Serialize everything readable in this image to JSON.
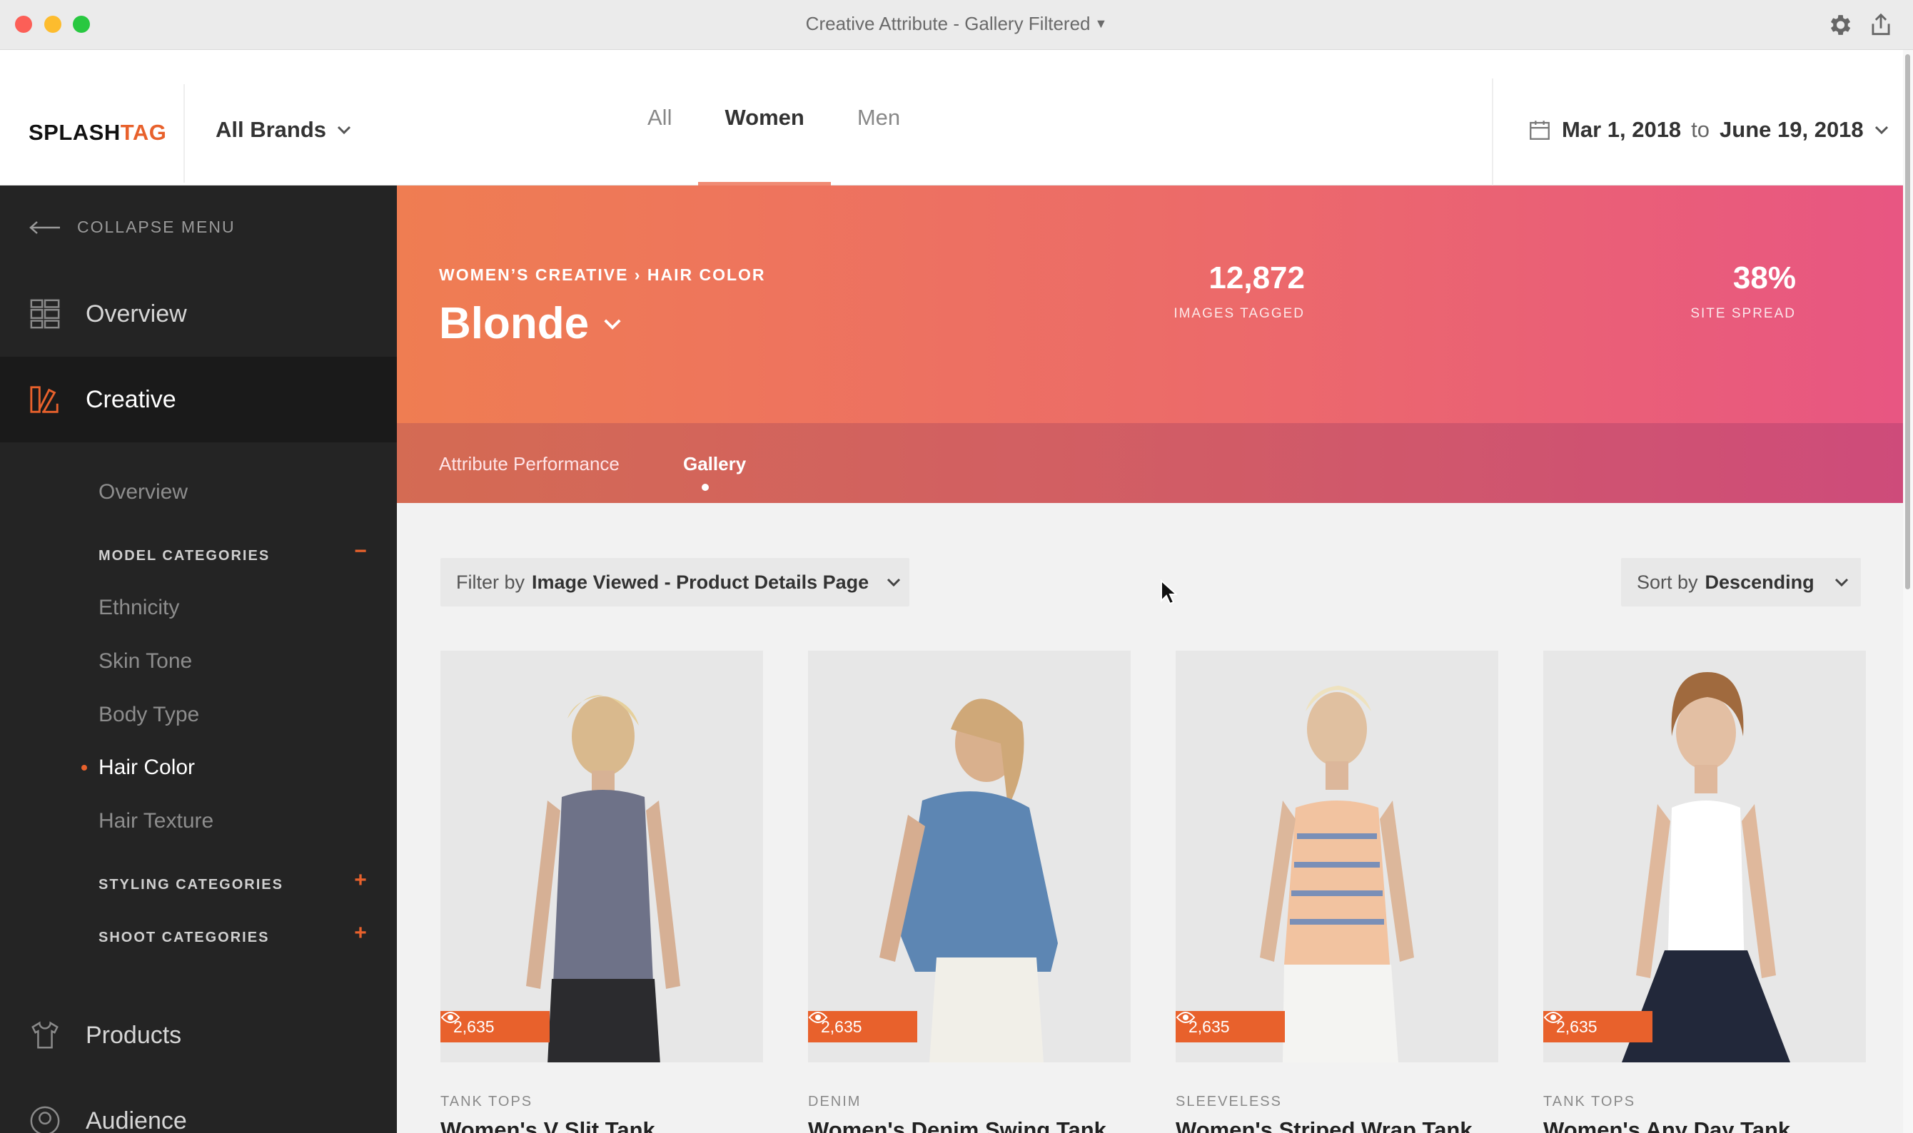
{
  "window": {
    "title": "Creative Attribute - Gallery Filtered"
  },
  "header": {
    "logo": {
      "text_a": "SPLASH",
      "text_b": "TAG"
    },
    "brand_selector": "All Brands",
    "gender_tabs": [
      {
        "label": "All",
        "active": false
      },
      {
        "label": "Women",
        "active": true
      },
      {
        "label": "Men",
        "active": false
      }
    ],
    "date_range": {
      "start": "Mar 1, 2018",
      "connector": "to",
      "end": "June 19, 2018"
    }
  },
  "sidebar": {
    "collapse_label": "COLLAPSE MENU",
    "main_items": [
      {
        "label": "Overview",
        "icon": "dashboard-icon"
      },
      {
        "label": "Creative",
        "icon": "swatches-icon",
        "active": true
      },
      {
        "label": "Products",
        "icon": "shirt-icon"
      },
      {
        "label": "Audience",
        "icon": "person-icon"
      }
    ],
    "creative_overview": "Overview",
    "model_categories": {
      "label": "MODEL CATEGORIES",
      "toggle": "−",
      "items": [
        "Ethnicity",
        "Skin Tone",
        "Body Type",
        "Hair Color",
        "Hair Texture"
      ],
      "active_item": "Hair Color"
    },
    "styling_categories": {
      "label": "STYLING CATEGORIES",
      "toggle": "+"
    },
    "shoot_categories": {
      "label": "SHOOT CATEGORIES",
      "toggle": "+"
    }
  },
  "hero": {
    "breadcrumb": "WOMEN’S CREATIVE › HAIR COLOR",
    "title": "Blonde",
    "stats": [
      {
        "value": "12,872",
        "label": "IMAGES TAGGED"
      },
      {
        "value": "38%",
        "label": "SITE SPREAD"
      }
    ],
    "tabs": [
      {
        "label": "Attribute Performance",
        "active": false
      },
      {
        "label": "Gallery",
        "active": true
      }
    ],
    "colors": {
      "gradient_start": "#ef7d52",
      "gradient_end": "#e85682"
    }
  },
  "filter": {
    "prefix": "Filter by",
    "value": "Image Viewed - Product Details Page"
  },
  "sort": {
    "prefix": "Sort by",
    "value": "Descending"
  },
  "products": [
    {
      "category": "TANK TOPS",
      "name": "Women's V Slit Tank",
      "views": "2,635"
    },
    {
      "category": "DENIM",
      "name": "Women's Denim Swing Tank",
      "views": "2,635"
    },
    {
      "category": "SLEEVELESS",
      "name": "Women's Striped Wrap Tank",
      "views": "2,635"
    },
    {
      "category": "TANK TOPS",
      "name": "Women's Any Day Tank",
      "views": "2,635"
    }
  ],
  "accent_color": "#e8612c"
}
